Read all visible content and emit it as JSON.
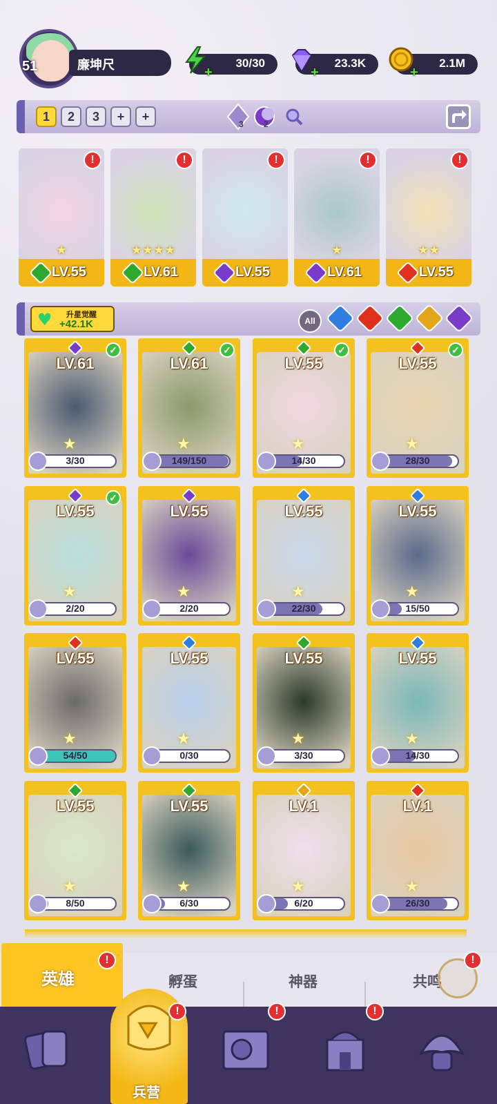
{
  "player": {
    "level": "51",
    "name": "廉坤尺"
  },
  "resources": [
    {
      "name": "energy",
      "icon": "lightning-icon",
      "value": "30/30",
      "color": "#4ad24a"
    },
    {
      "name": "gems",
      "icon": "diamond-icon",
      "value": "23.3K",
      "color": "#8a5cf5"
    },
    {
      "name": "gold",
      "icon": "coin-icon",
      "value": "2.1M",
      "color": "#f5c21d"
    }
  ],
  "team_tabs": [
    "1",
    "2",
    "3",
    "+",
    "+"
  ],
  "team_counters": {
    "c1": "3",
    "c2": "2"
  },
  "team": [
    {
      "level": "LV.55",
      "element": "nature",
      "stars": 1
    },
    {
      "level": "LV.61",
      "element": "nature",
      "stars": 4
    },
    {
      "level": "LV.55",
      "element": "dark",
      "stars": 0
    },
    {
      "level": "LV.61",
      "element": "dark",
      "stars": 1
    },
    {
      "level": "LV.55",
      "element": "fire",
      "stars": 2
    }
  ],
  "awaken": {
    "label": "升星觉醒",
    "value": "+42.1K"
  },
  "filter": {
    "all_label": "All",
    "elements": [
      "water",
      "fire",
      "nature",
      "light",
      "dark"
    ]
  },
  "heroes": [
    {
      "level": "LV.61",
      "element": "dark",
      "progress": "3/30",
      "ratio": 0.1,
      "check": true
    },
    {
      "level": "LV.61",
      "element": "nature",
      "progress": "149/150",
      "ratio": 0.99,
      "check": true
    },
    {
      "level": "LV.55",
      "element": "nature",
      "progress": "14/30",
      "ratio": 0.47,
      "check": true
    },
    {
      "level": "LV.55",
      "element": "fire",
      "progress": "28/30",
      "ratio": 0.93,
      "check": true
    },
    {
      "level": "LV.55",
      "element": "dark",
      "progress": "2/20",
      "ratio": 0.1,
      "check": true
    },
    {
      "level": "LV.55",
      "element": "dark",
      "progress": "2/20",
      "ratio": 0.1,
      "check": false
    },
    {
      "level": "LV.55",
      "element": "water",
      "progress": "22/30",
      "ratio": 0.73,
      "check": false
    },
    {
      "level": "LV.55",
      "element": "water",
      "progress": "15/50",
      "ratio": 0.3,
      "check": false
    },
    {
      "level": "LV.55",
      "element": "fire",
      "progress": "54/50",
      "ratio": 1.0,
      "check": false
    },
    {
      "level": "LV.55",
      "element": "water",
      "progress": "0/30",
      "ratio": 0.0,
      "check": false
    },
    {
      "level": "LV.55",
      "element": "nature",
      "progress": "3/30",
      "ratio": 0.1,
      "check": false
    },
    {
      "level": "LV.55",
      "element": "water",
      "progress": "14/30",
      "ratio": 0.47,
      "check": false
    },
    {
      "level": "LV.55",
      "element": "nature",
      "progress": "8/50",
      "ratio": 0.16,
      "check": false
    },
    {
      "level": "LV.55",
      "element": "nature",
      "progress": "6/30",
      "ratio": 0.2,
      "check": false
    },
    {
      "level": "LV.1",
      "element": "light",
      "progress": "6/20",
      "ratio": 0.3,
      "check": false
    },
    {
      "level": "LV.1",
      "element": "fire",
      "progress": "26/30",
      "ratio": 0.87,
      "check": false
    }
  ],
  "element_colors": {
    "nature": "#2ea82e",
    "dark": "#7a3cc8",
    "fire": "#e0301e",
    "water": "#2e7de0",
    "light": "#e3a51a"
  },
  "sub_tabs": [
    "英雄",
    "孵蛋",
    "神器",
    "共鸣"
  ],
  "nav": {
    "barracks": "兵营"
  },
  "alert_mark": "!",
  "check_mark": "✓",
  "plus_mark": "+",
  "star_glyph": "★"
}
